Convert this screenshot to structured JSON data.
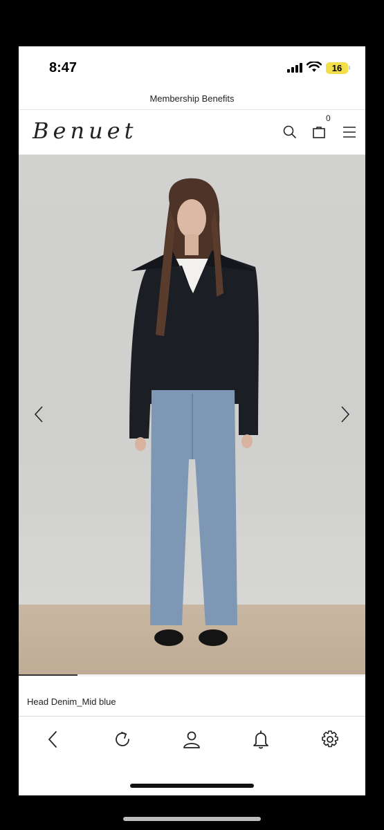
{
  "status_bar": {
    "time": "8:47",
    "battery_level": "16",
    "signal_icon": "cellular-signal-icon",
    "wifi_icon": "wifi-icon"
  },
  "banner": {
    "text": "Membership Benefits"
  },
  "header": {
    "logo": "Benuet",
    "search_icon": "search-icon",
    "cart_icon": "shopping-bag-icon",
    "cart_count": "0",
    "menu_icon": "hamburger-menu-icon"
  },
  "product": {
    "image_description": "model-wearing-cardigan-and-jeans",
    "image_position": "1 of 11",
    "carousel_progress": 0.17,
    "name": "Head Denim_Mid blue"
  },
  "toolbar": {
    "icons": [
      "back-icon",
      "reload-icon",
      "account-icon",
      "notifications-icon",
      "settings-icon"
    ]
  },
  "colors": {
    "battery": "#f1de4a",
    "wall": "#d1d1cf",
    "floor": "#c4b29c",
    "cardigan": "#1a1d24",
    "denim": "#7d97b4"
  }
}
